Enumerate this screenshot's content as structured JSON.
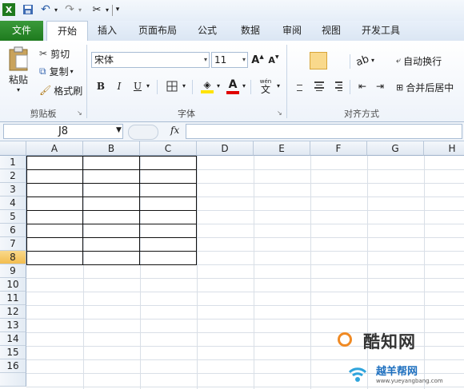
{
  "quick_access": {
    "app_icon": "excel-x-icon",
    "items": [
      "save-icon",
      "undo-icon",
      "redo-icon",
      "customize-icon"
    ]
  },
  "tabs": [
    {
      "label": "文件"
    },
    {
      "label": "开始"
    },
    {
      "label": "插入"
    },
    {
      "label": "页面布局"
    },
    {
      "label": "公式"
    },
    {
      "label": "数据"
    },
    {
      "label": "审阅"
    },
    {
      "label": "视图"
    },
    {
      "label": "开发工具"
    }
  ],
  "clipboard": {
    "paste": "粘贴",
    "cut": "剪切",
    "copy": "复制",
    "format_painter": "格式刷",
    "group_label": "剪贴板"
  },
  "font": {
    "name": "宋体",
    "size": "11",
    "grow": "A",
    "shrink": "A",
    "bold": "B",
    "italic": "I",
    "underline": "U",
    "font_color_glyph": "A",
    "phonetic": "wén",
    "group_label": "字体"
  },
  "alignment": {
    "wrap_text": "自动换行",
    "merge_center": "合并后居中",
    "group_label": "对齐方式"
  },
  "formula_bar": {
    "name_box": "J8",
    "fx": "fx",
    "value": ""
  },
  "sheet": {
    "columns": [
      "A",
      "B",
      "C",
      "D",
      "E",
      "F",
      "G",
      "H"
    ],
    "rows": [
      "1",
      "2",
      "3",
      "4",
      "5",
      "6",
      "7",
      "8",
      "9",
      "10",
      "11",
      "12",
      "13",
      "14",
      "15",
      "16"
    ],
    "selected_row": "8",
    "bordered_range": "A1:C8"
  },
  "watermark": {
    "brand": "酷知网",
    "site_cn": "越羊帮网",
    "url": "www.yueyangbang.com"
  },
  "colors": {
    "file_tab": "#1e7a1e",
    "accent": "#2b579a",
    "selected_header": "#f3bd4e",
    "highlight_yellow": "#ffe300",
    "font_red": "#e00000"
  }
}
